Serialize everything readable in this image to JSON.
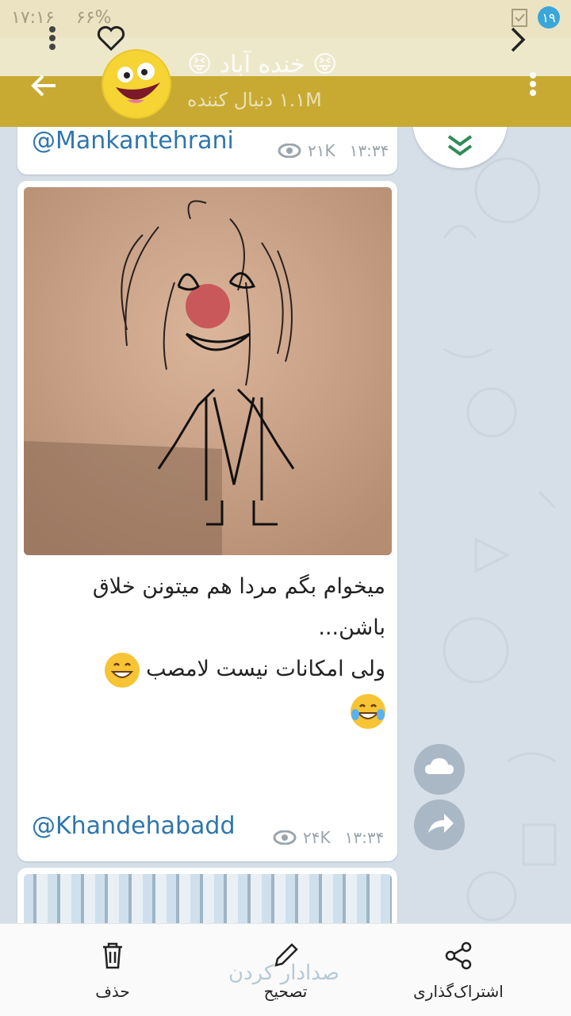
{
  "status_bar": {
    "time": "۱۷:۱۶",
    "battery": "۶۶%",
    "notification_count": "۱۹"
  },
  "channel": {
    "title": "😝 خنده آباد 😝",
    "subscribers": "۱.۱M دنبال کننده"
  },
  "messages": [
    {
      "link": "@Mankantehrani",
      "views": "۲۱K",
      "time": "۱۳:۳۴"
    },
    {
      "text_line1": "میخوام بگم مردا هم میتونن خلاق باشن...",
      "text_line2": "ولی امکانات نیست لامصب",
      "link": "@Khandehabadd",
      "views": "۲۴K",
      "time": "۱۳:۳۴"
    }
  ],
  "bottom_actions": {
    "share": "اشتراک‌گذاری",
    "edit": "تصحیح",
    "delete": "حذف",
    "ghost": "صدادار کردن"
  }
}
